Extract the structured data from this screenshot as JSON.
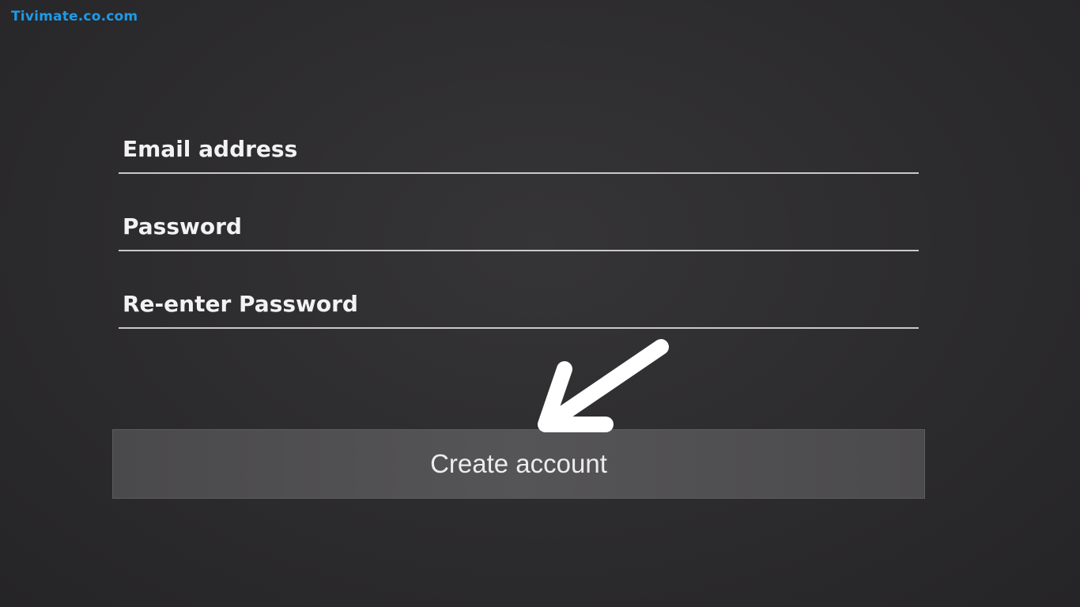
{
  "watermark": "Tivimate.co.com",
  "form": {
    "email_placeholder": "Email address",
    "password_placeholder": "Password",
    "reenter_placeholder": "Re-enter Password",
    "create_label": "Create account"
  },
  "icons": {
    "pointer": "arrow-icon"
  },
  "colors": {
    "watermark": "#1e9ae8",
    "background": "#2c2b2d",
    "button": "#525153",
    "text": "#f2f2f2"
  }
}
